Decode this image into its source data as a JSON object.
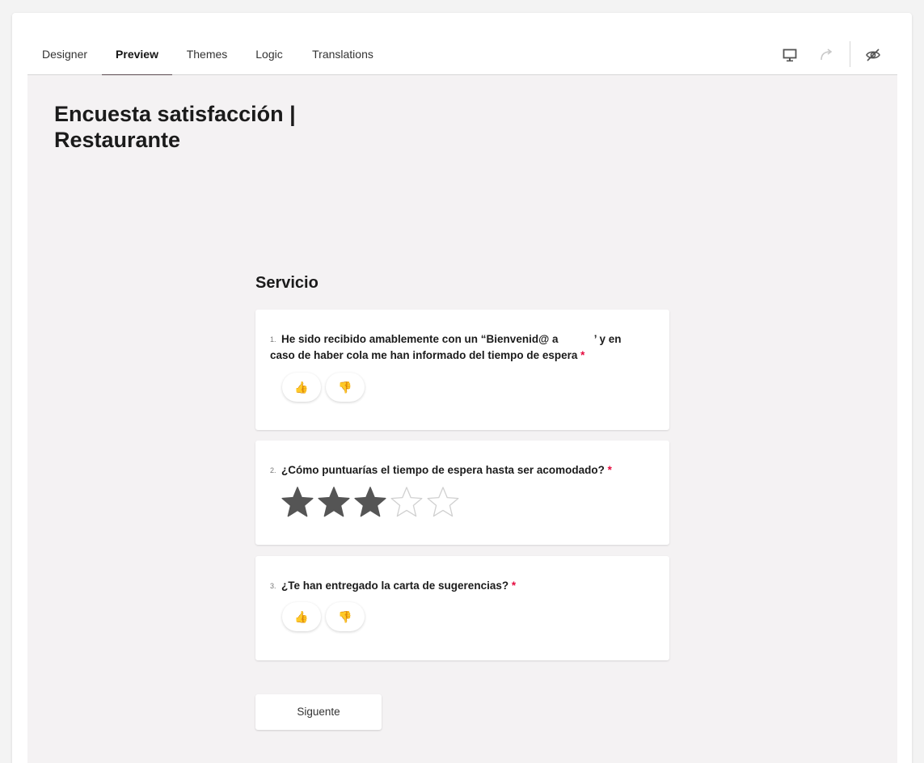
{
  "tabs": [
    {
      "label": "Designer",
      "active": false
    },
    {
      "label": "Preview",
      "active": true
    },
    {
      "label": "Themes",
      "active": false
    },
    {
      "label": "Logic",
      "active": false
    },
    {
      "label": "Translations",
      "active": false
    }
  ],
  "toolbar": {
    "icons": [
      "desktop-icon",
      "redo-icon",
      "eye-off-icon"
    ]
  },
  "survey": {
    "title": "Encuesta satisfacción | Restaurante",
    "section": "Servicio",
    "questions": [
      {
        "number": "1.",
        "text": "He sido recibido amablemente con un “Bienvenid@ a    ’ y en caso de haber cola me han informado del tiempo de espera",
        "required": "*",
        "type": "thumbs",
        "options": [
          "👍",
          "👎"
        ]
      },
      {
        "number": "2.",
        "text": "¿Cómo puntuarías el tiempo de espera hasta ser acomodado?",
        "required": "*",
        "type": "rating",
        "rating": 3,
        "max": 5
      },
      {
        "number": "3.",
        "text": "¿Te han entregado la carta de sugerencias?",
        "required": "*",
        "type": "thumbs",
        "options": [
          "👍",
          "👎"
        ]
      }
    ],
    "next_label": "Siguente"
  },
  "colors": {
    "accent": "#5a4a50",
    "required": "#e50a3e",
    "star_filled": "#555555",
    "star_empty": "#d0d0d0"
  }
}
